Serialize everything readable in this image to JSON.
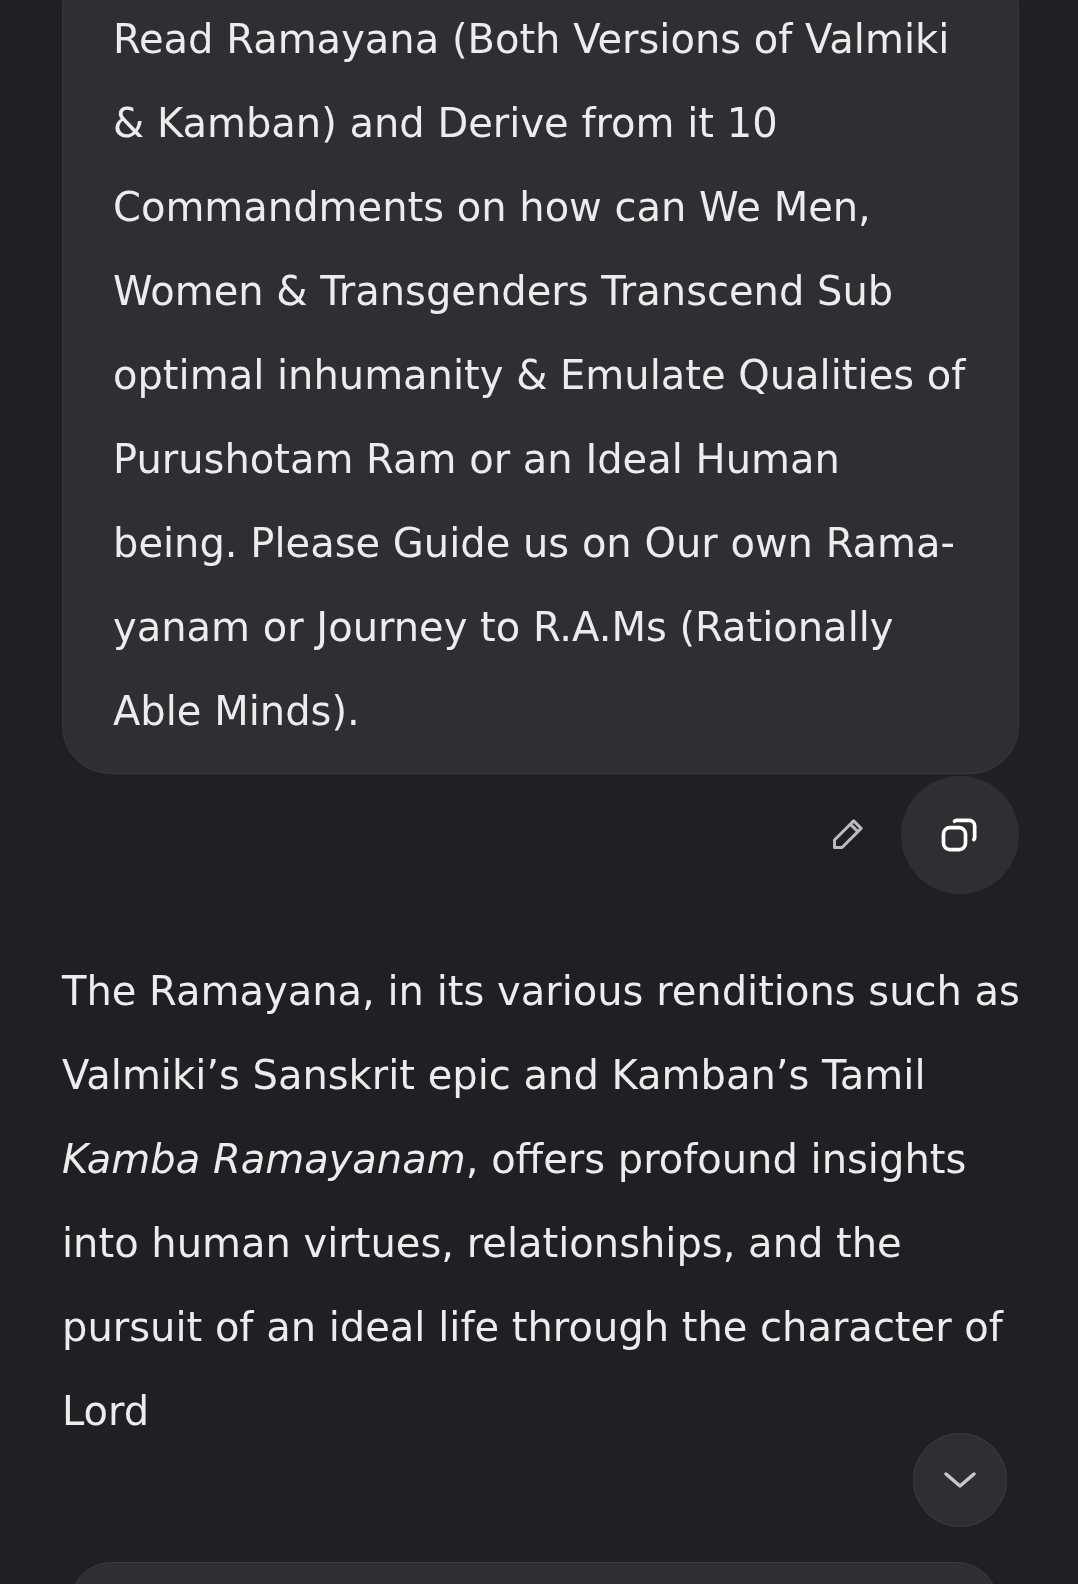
{
  "user_message": {
    "text": "Read Ramayana (Both Versions of Valmiki & Kamban) and Derive from it 10 Commandments on how can We Men, Women & Transgenders Transcend Sub optimal inhumanity & Emulate Qualities of Purushotam Ram or an Ideal Human being. Please Guide us on Our own Rama-yanam or Journey to R.A.Ms (Rationally Able Minds)."
  },
  "response": {
    "text": "The Ramayana, in its various renditions such as Valmiki’s Sanskrit epic and Kamban’s Tamil *Kamba Ramayanam*, offers profound insights into human virtues, relationships, and the pursuit of an ideal life through the character of Lord"
  }
}
